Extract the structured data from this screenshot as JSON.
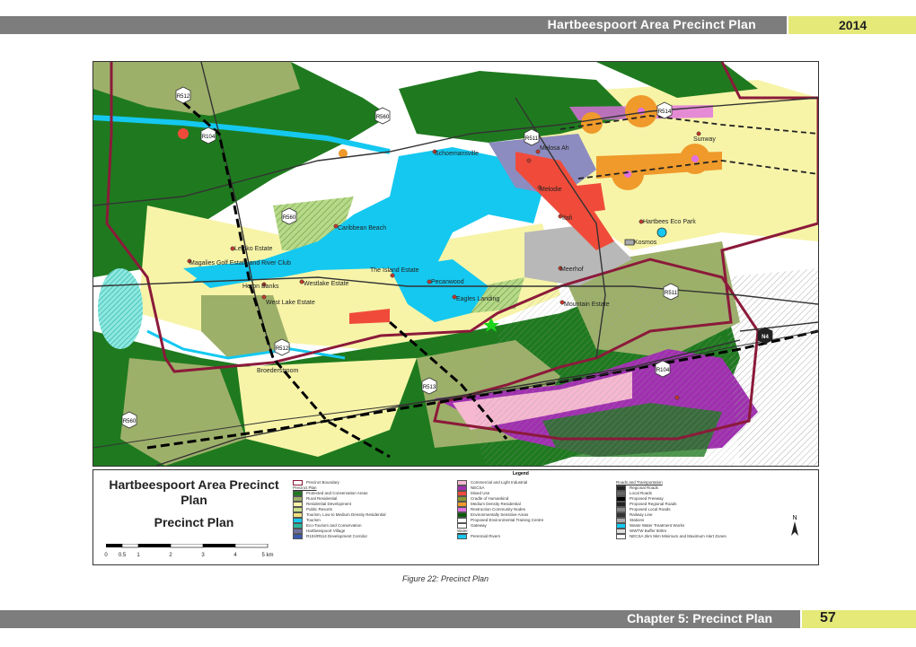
{
  "header": {
    "title": "Hartbeespoort Area Precinct Plan",
    "year": "2014"
  },
  "footer": {
    "chapter": "Chapter 5: Precinct Plan",
    "page": "57"
  },
  "caption": "Figure 22:    Precinct Plan",
  "map": {
    "places": [
      {
        "name": "Sunway"
      },
      {
        "name": "Meerhof"
      },
      {
        "name": "Schoemansville"
      },
      {
        "name": "Melodie"
      },
      {
        "name": "Ifafi"
      },
      {
        "name": "Caribbean Beach"
      },
      {
        "name": "Leloko Estate"
      },
      {
        "name": "Magalies Golf Estate and River Club"
      },
      {
        "name": "The Island Estate"
      },
      {
        "name": "Pecanwood"
      },
      {
        "name": "Westlake Estate"
      },
      {
        "name": "Heron Banks"
      },
      {
        "name": "West Lake Estate"
      },
      {
        "name": "Eagles Landing"
      },
      {
        "name": "Mountain Estate"
      },
      {
        "name": "Kosmos"
      },
      {
        "name": "Hartbees Eco Park"
      },
      {
        "name": "Melosa Ah"
      },
      {
        "name": "Broederstroom"
      }
    ],
    "roads": [
      "R512",
      "R560",
      "R104",
      "R511",
      "R513",
      "N4",
      "R566"
    ],
    "colors": {
      "dam": "#14c8f0",
      "conservation": "#1f7a1f",
      "rural": "#9db06a",
      "residential": "#f7f4a8",
      "mixed_use": "#f04b3a",
      "nodes": "#ef9a2a"
    }
  },
  "legend": {
    "heading": "Legend",
    "title": "Hartbeespoort Area Precinct Plan",
    "subtitle": "Precinct Plan",
    "scale": {
      "ticks": [
        "0",
        "0.5",
        "1",
        "2",
        "3",
        "4",
        "5 km"
      ]
    },
    "col1": [
      {
        "label": "Precinct Boundary",
        "color": "#ffffff",
        "border": "#8b1a3a"
      },
      {
        "label": "Precinct Plan",
        "header": true
      },
      {
        "label": "Protected and Conservation Areas",
        "color": "#1f7a1f"
      },
      {
        "label": "Rural Residential",
        "color": "#9db06a"
      },
      {
        "label": "Residential Development",
        "color": "#f7f4a8"
      },
      {
        "label": "Public Resorts",
        "color": "#c8e08a"
      },
      {
        "label": "Tourism, Low to Medium Density Residential",
        "color": "#f0e080"
      },
      {
        "label": "Tourism",
        "color": "#14c8f0"
      },
      {
        "label": "Eco-Tourism and Conservation",
        "color": "#2ab8a0"
      },
      {
        "label": "Hartbeespoort Village",
        "color": "#7070a0"
      },
      {
        "label": "R104/R514 Development Corridor",
        "color": "#3a5ab0"
      }
    ],
    "col2": [
      {
        "label": "Commercial and Light Industrial",
        "color": "#f5b8d0"
      },
      {
        "label": "NECSA",
        "color": "#a030b0"
      },
      {
        "label": "Mixed Use",
        "color": "#f04b3a"
      },
      {
        "label": "Cradle of Humankind",
        "color": "#8a9a30"
      },
      {
        "label": "Medium Density Residential",
        "color": "#ef9a2a"
      },
      {
        "label": "Restruction Community Nodes",
        "color": "#e070e0"
      },
      {
        "label": "Environmentally Sensitive Areas",
        "color": "#0c5a0c"
      },
      {
        "label": "Proposed Environmental Training Centre",
        "color": "#ffffff"
      },
      {
        "label": "Gateway",
        "color": "#ffffff"
      },
      {
        "label": "Water",
        "header": true
      },
      {
        "label": "Perennial Rivers",
        "color": "#14c8f0"
      }
    ],
    "col3": [
      {
        "label": "Roads and Transportation",
        "header": true
      },
      {
        "label": "Regional Roads",
        "color": "#222222"
      },
      {
        "label": "Local Roads",
        "color": "#666666"
      },
      {
        "label": "Proposed Freeway",
        "color": "#000000"
      },
      {
        "label": "Proposed Regional Roads",
        "color": "#222222"
      },
      {
        "label": "Proposed Local Roads",
        "color": "#888888"
      },
      {
        "label": "Railway Line",
        "color": "#333333"
      },
      {
        "label": "Stations",
        "color": "#aaaaaa"
      },
      {
        "label": "Waste Water Treatment Works",
        "color": "#14c8f0"
      },
      {
        "label": "WWTW Buffer 600m",
        "color": "#dddddd"
      },
      {
        "label": "NECSA 2km 5km Minimum and Maximum Alert Zones",
        "color": "#ffffff"
      }
    ]
  }
}
